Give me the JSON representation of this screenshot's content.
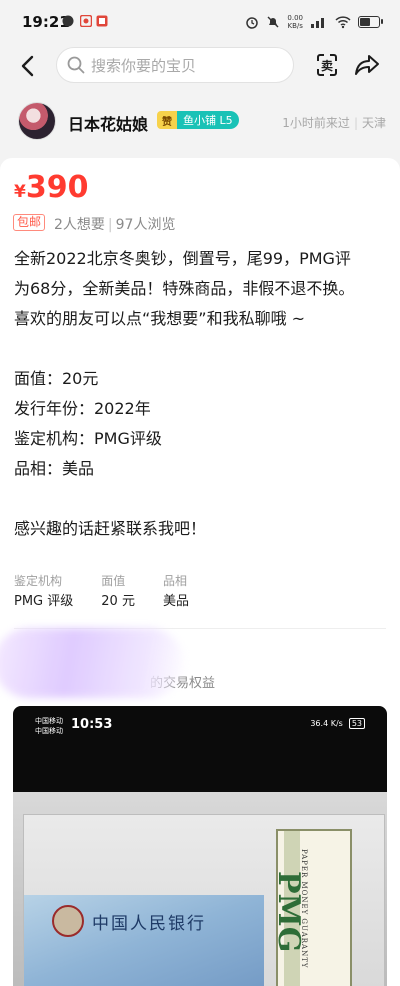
{
  "status_bar": {
    "time": "19:21",
    "net_speed_value": "0.00",
    "net_speed_unit": "KB/s"
  },
  "nav": {
    "search_placeholder": "搜索你要的宝贝",
    "sell_label": "卖"
  },
  "seller": {
    "name": "日本花姑娘",
    "zan_badge": "赞",
    "shop_badge": "鱼小铺 L5",
    "last_seen": "1小时前来过",
    "location": "天津"
  },
  "item": {
    "currency": "¥",
    "price": "390",
    "shipping_tag": "包邮",
    "wants": "2人想要",
    "views": "97人浏览",
    "description_lines": [
      "全新2022北京冬奥钞，倒置号，尾99，PMG评",
      "为68分，全新美品！特殊商品，非假不退不换。",
      "喜欢的朋友可以点“我想要”和我私聊哦 ~",
      "",
      "面值：20元",
      "发行年份：2022年",
      "鉴定机构：PMG评级",
      "品相：美品",
      "",
      "感兴趣的话赶紧联系我吧！"
    ],
    "attributes": [
      {
        "key": "鉴定机构",
        "value": "PMG 评级"
      },
      {
        "key": "面值",
        "value": "20 元"
      },
      {
        "key": "品相",
        "value": "美品"
      }
    ],
    "guarantee_text": "的交易权益"
  },
  "photo": {
    "carrier_line1": "中国移动",
    "carrier_line2": "中国移动",
    "time": "10:53",
    "net": "36.4 K/s",
    "battery": "53",
    "banknote_text": "中国人民银行",
    "pmg_logo": "PMG",
    "pmg_sub": "PAPER MONEY GUARANTY"
  }
}
